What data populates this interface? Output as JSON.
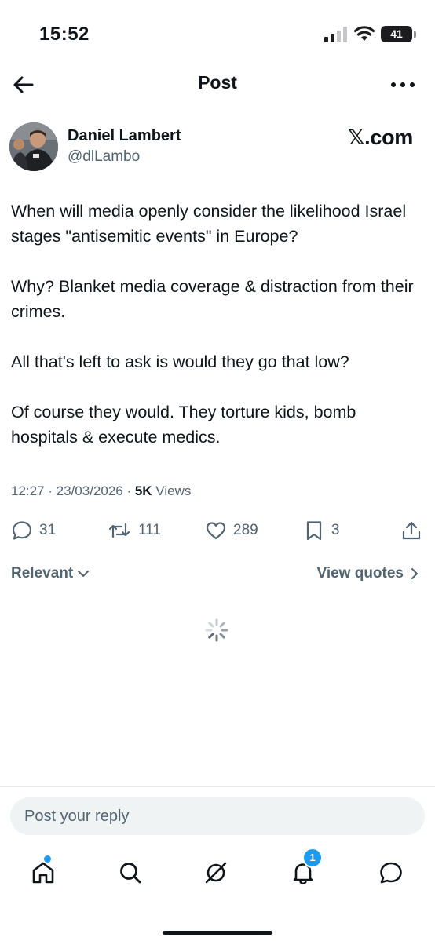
{
  "status_bar": {
    "time": "15:52",
    "battery": "41"
  },
  "header": {
    "title": "Post",
    "back_icon": "arrow-left-icon",
    "more_icon": "more-horizontal-icon"
  },
  "author": {
    "name": "Daniel Lambert",
    "handle": "@dlLambo",
    "source_label": "𝕏.com"
  },
  "post": {
    "paragraphs": [
      "When will media openly consider the likelihood Israel stages \"antisemitic events\" in Europe?",
      "Why? Blanket media coverage & distraction from their crimes.",
      "All that's left to ask is would they go that low?",
      "Of course they would. They torture kids, bomb hospitals & execute medics."
    ],
    "timestamp": "12:27 · 23/03/2026 · ",
    "views_count": "5K",
    "views_label": " Views"
  },
  "actions": {
    "replies": "31",
    "reposts": "111",
    "likes": "289",
    "bookmarks": "3"
  },
  "filters": {
    "sort_label": "Relevant",
    "quotes_label": "View quotes"
  },
  "reply": {
    "placeholder": "Post your reply"
  },
  "tab_bar": {
    "notifications_badge": "1",
    "tabs": [
      "home-icon",
      "search-icon",
      "grok-icon",
      "notifications-icon",
      "messages-icon"
    ]
  },
  "colors": {
    "text": "#0f1419",
    "secondary": "#536471",
    "accent": "#1d9bf0",
    "reply_bg": "#eff3f4"
  }
}
